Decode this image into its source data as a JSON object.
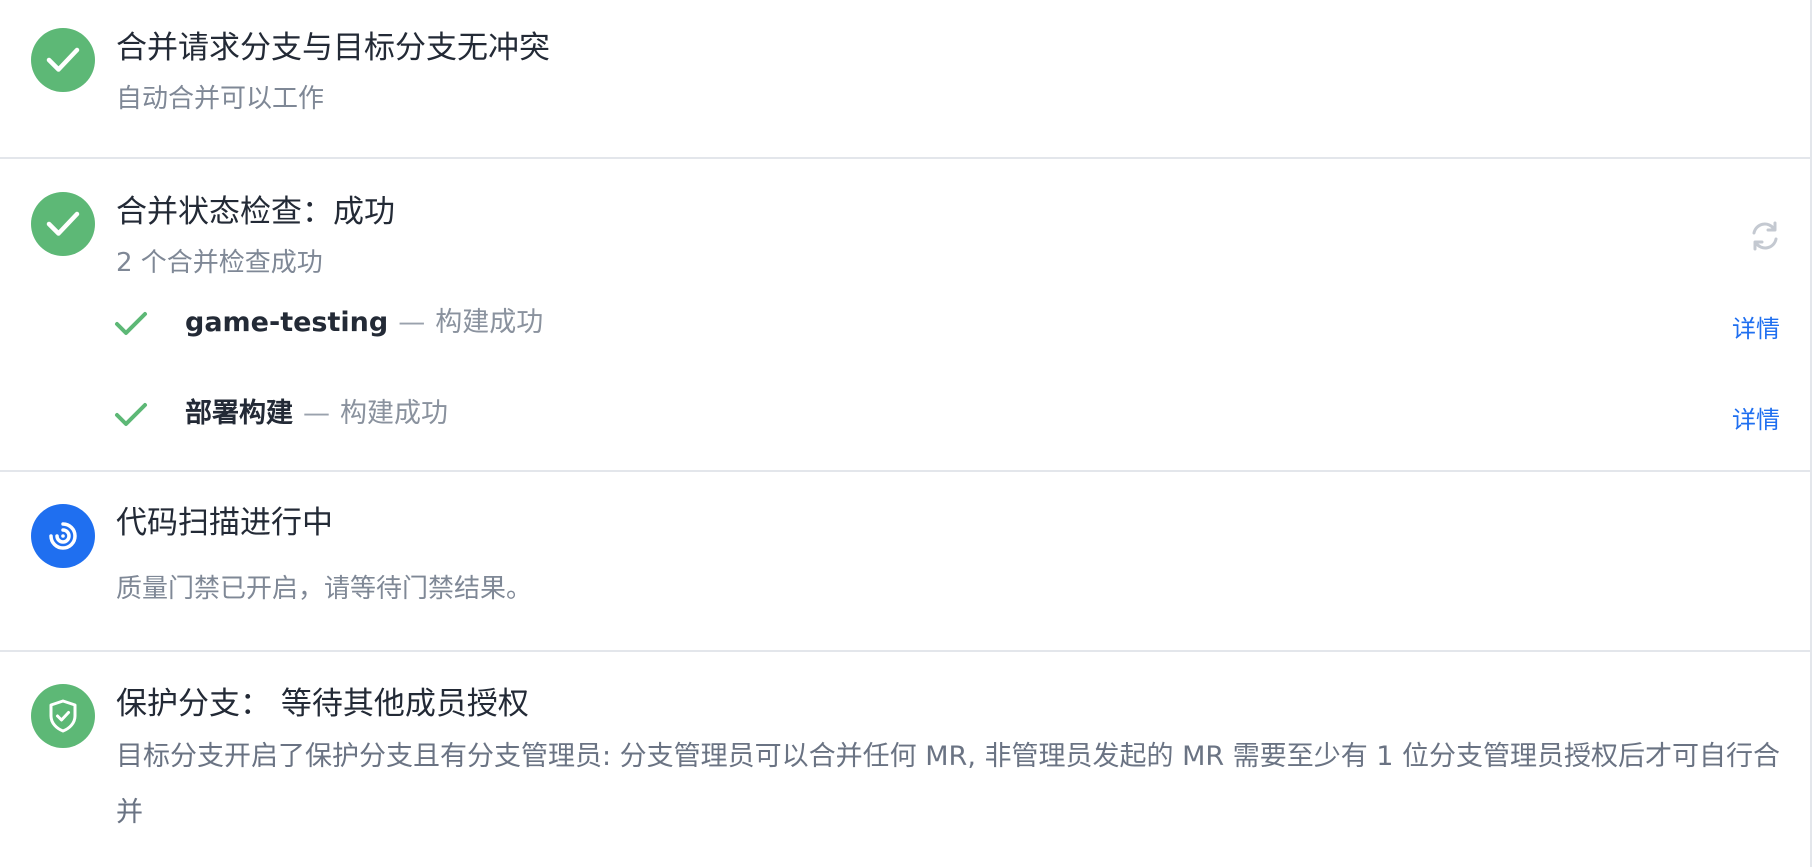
{
  "sections": {
    "conflict": {
      "title": "合并请求分支与目标分支无冲突",
      "subtitle": "自动合并可以工作",
      "icon": "check-circle-icon",
      "color": "#5db876"
    },
    "status_check": {
      "title": "合并状态检查：成功",
      "subtitle": "2 个合并检查成功",
      "icon": "check-circle-icon",
      "refresh_icon": "refresh-icon",
      "checks": [
        {
          "name": "game-testing",
          "dash": "—",
          "status": "构建成功",
          "detail_label": "详情",
          "icon": "check-icon"
        },
        {
          "name": "部署构建",
          "dash": "—",
          "status": "构建成功",
          "detail_label": "详情",
          "icon": "check-icon"
        }
      ]
    },
    "code_scan": {
      "title": "代码扫描进行中",
      "subtitle": "质量门禁已开启，请等待门禁结果。",
      "icon": "scan-spinner-icon",
      "color": "#1f6ff0"
    },
    "protected_branch": {
      "title": "保护分支：  等待其他成员授权",
      "description": "目标分支开启了保护分支且有分支管理员: 分支管理员可以合并任何 MR, 非管理员发起的 MR 需要至少有 1 位分支管理员授权后才可自行合并",
      "icon": "shield-check-icon"
    }
  },
  "colors": {
    "success": "#5db876",
    "link": "#1f6ff0",
    "text_primary": "#232a36",
    "text_secondary": "#7f8896"
  }
}
